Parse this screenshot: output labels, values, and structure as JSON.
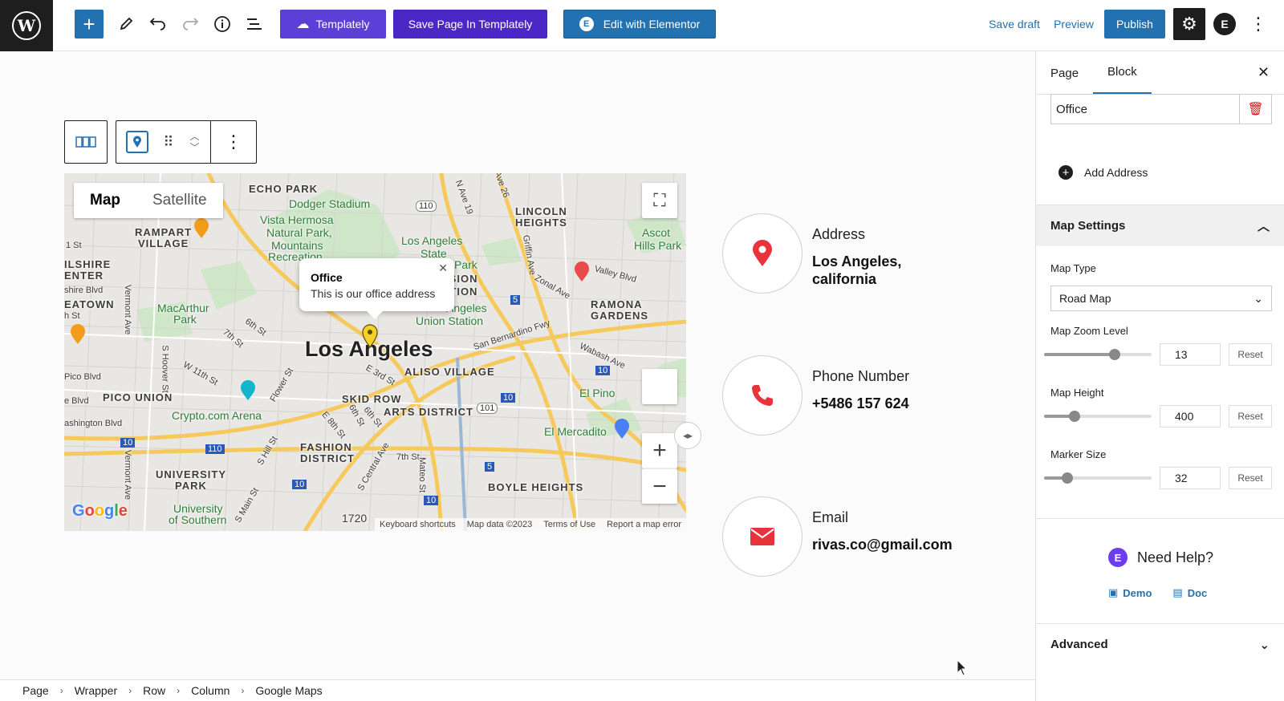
{
  "toolbar": {
    "templately_label": "Templately",
    "save_templately_label": "Save Page In Templately",
    "elementor_label": "Edit with Elementor",
    "save_draft_label": "Save draft",
    "preview_label": "Preview",
    "publish_label": "Publish"
  },
  "map": {
    "tab_map": "Map",
    "tab_satellite": "Satellite",
    "info_title": "Office",
    "info_text": "This is our office address",
    "labels": {
      "echo_park": "ECHO PARK",
      "dodger": "Dodger Stadium",
      "vista": "Vista Hermosa",
      "natural_park": "Natural Park,",
      "mountains": "Mountains",
      "recreation": "Recreation",
      "la_state": "Los Angeles",
      "state": "State",
      "park_word": "Park",
      "lincoln": "LINCOLN",
      "heights": "HEIGHTS",
      "ascot": "Ascot",
      "hills_park": "Hills Park",
      "rampart": "RAMPART",
      "village": "VILLAGE",
      "wilshire": "ILSHIRE",
      "center": "ENTER",
      "eatown": "EATOWN",
      "macarthur": "MacArthur",
      "macarthur_park": "Park",
      "mission": "SSION",
      "junction": "CTION",
      "union_la": "Angeles",
      "union_station": "Union Station",
      "ramona": "RAMONA",
      "gardens": "GARDENS",
      "city": "Los Angeles",
      "aliso": "ALISO VILLAGE",
      "el_pino": "El Pino",
      "pico_union": "PICO UNION",
      "skid_row": "SKID ROW",
      "arts": "ARTS DISTRICT",
      "crypto": "Crypto.com Arena",
      "el_mercadito": "El Mercadito",
      "fashion": "FASHION",
      "district": "DISTRICT",
      "university": "UNIVERSITY",
      "univ_park": "PARK",
      "usc": "University",
      "of_southern": "of Southern",
      "boyle": "BOYLE HEIGHTS",
      "pico_blvd": "Pico Blvd",
      "washington": "ashington Blvd",
      "st1": "1 St",
      "shire_blvd": "shire Blvd",
      "h_st": "h St",
      "e_blvd": "e Blvd",
      "sixth": "6th St",
      "seventh": "7th St",
      "wabash": "Wabash Ave",
      "valley": "Valley Blvd",
      "zonal": "Zonal Ave",
      "san_bern": "San Bernardino Fwy",
      "e3rd": "E 3rd St",
      "e6th": "6th St",
      "e7th": "7th St",
      "e8th": "E 8th St",
      "flower": "Flower St",
      "w11": "W 11th St",
      "s_hoover": "S Hoover St",
      "vermont": "Vermont Ave",
      "vermont2": "Vermont Ave",
      "griffin": "Griffin Ave",
      "ave26": "Ave 26",
      "n_ave19": "N Ave 19",
      "s_hill": "S Hill St",
      "s_main": "S Main St",
      "central": "S Central Ave",
      "mateo": "Mateo St",
      "s_sixth": "6th St",
      "num_1720": "1720"
    },
    "footer": {
      "shortcuts": "Keyboard shortcuts",
      "data": "Map data ©2023",
      "terms": "Terms of Use",
      "report": "Report a map error"
    },
    "shields": {
      "s110a": "110",
      "s5a": "5",
      "s10a": "10",
      "s110b": "110",
      "s10b": "10",
      "s101": "101",
      "s10c": "10",
      "s5b": "5",
      "s10d": "10",
      "s10e": "10"
    }
  },
  "contacts": [
    {
      "title": "Address",
      "value": "Los Angeles, california"
    },
    {
      "title": "Phone Number",
      "value": "+5486 157 624"
    },
    {
      "title": "Email",
      "value": "rivas.co@gmail.com"
    }
  ],
  "breadcrumb": [
    "Page",
    "Wrapper",
    "Row",
    "Column",
    "Google Maps"
  ],
  "sidebar": {
    "tab_page": "Page",
    "tab_block": "Block",
    "office_value": "Office",
    "add_address": "Add Address",
    "map_settings": "Map Settings",
    "map_type_label": "Map Type",
    "map_type_value": "Road Map",
    "zoom_label": "Map Zoom Level",
    "zoom_value": "13",
    "height_label": "Map Height",
    "height_value": "400",
    "marker_label": "Marker Size",
    "marker_value": "32",
    "reset_label": "Reset",
    "help_title": "Need Help?",
    "demo_label": "Demo",
    "doc_label": "Doc",
    "advanced": "Advanced"
  },
  "sliders": {
    "zoom_fraction": 0.66,
    "height_fraction": 0.28,
    "marker_fraction": 0.22
  },
  "colors": {
    "accent": "#2271b1",
    "templately": "#5b3fd6",
    "icon_red": "#e8333a"
  }
}
